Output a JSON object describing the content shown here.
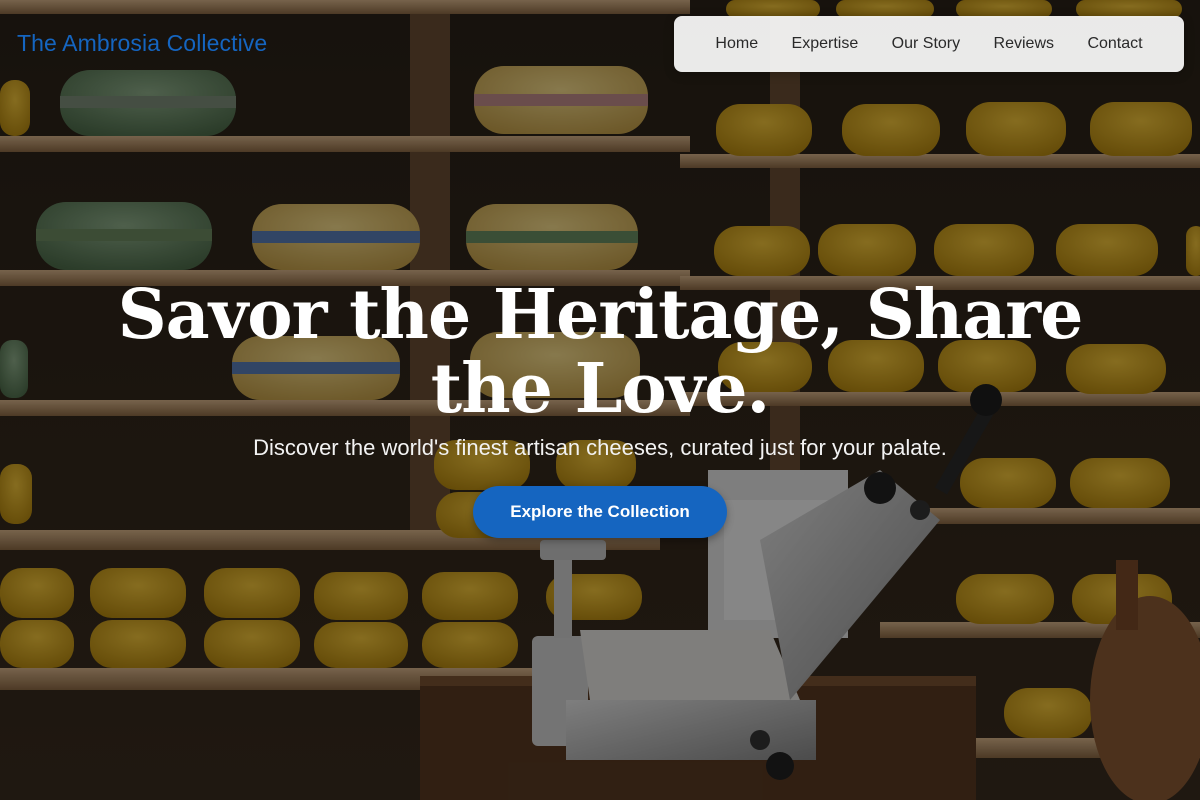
{
  "site": {
    "brand": "The Ambrosia Collective"
  },
  "nav": {
    "items": [
      {
        "label": "Home"
      },
      {
        "label": "Expertise"
      },
      {
        "label": "Our Story"
      },
      {
        "label": "Reviews"
      },
      {
        "label": "Contact"
      }
    ]
  },
  "hero": {
    "headline": "Savor the Heritage, Share the Love.",
    "subheadline": "Discover the world's finest artisan cheeses, curated just for your palate.",
    "cta_label": "Explore the Collection",
    "background_description": "cheese-shop-shelves-photo"
  },
  "colors": {
    "accent": "#1565c0",
    "nav_background": "#f5f5f5",
    "headline": "#ffffff"
  }
}
